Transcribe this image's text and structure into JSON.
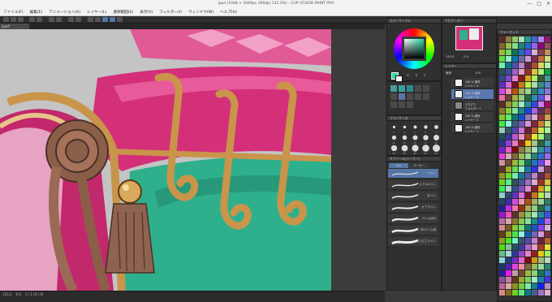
{
  "window": {
    "title": "ipad (1048 × 1949px 300dpi 133.3%) - CLIP STUDIO PAINT PRO",
    "controls": [
      "—",
      "□",
      "✕"
    ]
  },
  "menu": {
    "items": [
      "ファイル(F)",
      "編集(E)",
      "アニメーション(A)",
      "レイヤー(L)",
      "選択範囲(S)",
      "表示(V)",
      "フィルター(I)",
      "ウィンドウ(W)",
      "ヘルプ(H)"
    ]
  },
  "canvas_tab": {
    "label": "ipad*"
  },
  "status": {
    "zoom": "133.3",
    "angle": "0.0",
    "info": "1 / 1 (0 / 0)"
  },
  "color_panel": {
    "title": "カラーサークル",
    "values": [
      "H",
      "S",
      "V"
    ]
  },
  "navigator_panel": {
    "title": "ナビゲーター",
    "zoom": "133.3",
    "angle": "0.0"
  },
  "brush_size_panel": {
    "title": "ブラシサイズ",
    "sizes": [
      "1",
      "2",
      "3",
      "5",
      "7",
      "10",
      "12",
      "15",
      "17",
      "20",
      "25",
      "30",
      "40",
      "50",
      "60"
    ]
  },
  "subtool_panel": {
    "title": "サブツール[マーカー]",
    "tabs": [
      "ペン",
      "マーカー"
    ],
    "tools": [
      "Gペン",
      "リアルGペン",
      "丸ペン",
      "カブラペン",
      "ペン(太め)",
      "3Dベース用",
      "さらさらペン"
    ]
  },
  "layer_panel": {
    "title": "レイヤー",
    "blend": "通常",
    "opacity": "100",
    "layers": [
      {
        "line1": "100 % 通常",
        "line2": "レイヤー 4"
      },
      {
        "line1": "100 % 通常",
        "line2": "レイヤー 3"
      },
      {
        "line1": "ふちどり",
        "line2": "フォルダー 1"
      },
      {
        "line1": "100 % 通常",
        "line2": "レイヤー 2"
      },
      {
        "line1": "100 % 通常",
        "line2": "レイヤー 1"
      }
    ]
  },
  "palette_panel": {
    "title": "カラーセット"
  },
  "colors": {
    "accent": "#5a78ad",
    "pink": "#d4307a",
    "teal": "#2fb08c",
    "gold": "#c8954a"
  }
}
